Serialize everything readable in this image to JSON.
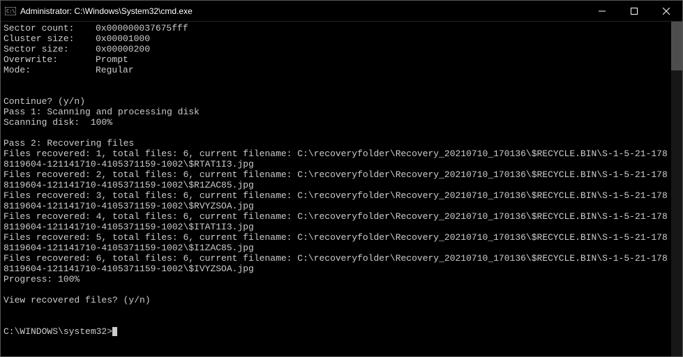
{
  "window": {
    "title": "Administrator: C:\\Windows\\System32\\cmd.exe"
  },
  "header": {
    "rows": [
      {
        "key": "Sector count:",
        "value": "0x000000037675fff"
      },
      {
        "key": "Cluster size:",
        "value": "0x00001000"
      },
      {
        "key": "Sector size:",
        "value": "0x00000200"
      },
      {
        "key": "Overwrite:",
        "value": "Prompt"
      },
      {
        "key": "Mode:",
        "value": "Regular"
      }
    ]
  },
  "continuePrompt": "Continue? (y/n)",
  "pass1": {
    "label": "Pass 1: Scanning and processing disk",
    "scan": "Scanning disk:  100%"
  },
  "pass2": {
    "label": "Pass 2: Recovering files",
    "files": [
      {
        "idx": "1",
        "total": "6",
        "path": "C:\\recoveryfolder\\Recovery_20210710_170136\\$RECYCLE.BIN\\S-1-5-21-1788119604-121141710-4105371159-1002\\$RTAT1I3.jpg"
      },
      {
        "idx": "2",
        "total": "6",
        "path": "C:\\recoveryfolder\\Recovery_20210710_170136\\$RECYCLE.BIN\\S-1-5-21-1788119604-121141710-4105371159-1002\\$R1ZAC85.jpg"
      },
      {
        "idx": "3",
        "total": "6",
        "path": "C:\\recoveryfolder\\Recovery_20210710_170136\\$RECYCLE.BIN\\S-1-5-21-1788119604-121141710-4105371159-1002\\$RVYZSOA.jpg"
      },
      {
        "idx": "4",
        "total": "6",
        "path": "C:\\recoveryfolder\\Recovery_20210710_170136\\$RECYCLE.BIN\\S-1-5-21-1788119604-121141710-4105371159-1002\\$ITAT1I3.jpg"
      },
      {
        "idx": "5",
        "total": "6",
        "path": "C:\\recoveryfolder\\Recovery_20210710_170136\\$RECYCLE.BIN\\S-1-5-21-1788119604-121141710-4105371159-1002\\$I1ZAC85.jpg"
      },
      {
        "idx": "6",
        "total": "6",
        "path": "C:\\recoveryfolder\\Recovery_20210710_170136\\$RECYCLE.BIN\\S-1-5-21-1788119604-121141710-4105371159-1002\\$IVYZSOA.jpg"
      }
    ],
    "progress": "Progress: 100%"
  },
  "viewPrompt": "View recovered files? (y/n)",
  "promptLine": "C:\\WINDOWS\\system32>",
  "labels": {
    "filesRecoveredPrefix": "Files recovered: ",
    "totalFilesPrefix": ", total files: ",
    "currentFilenamePrefix": ", current filename: "
  }
}
